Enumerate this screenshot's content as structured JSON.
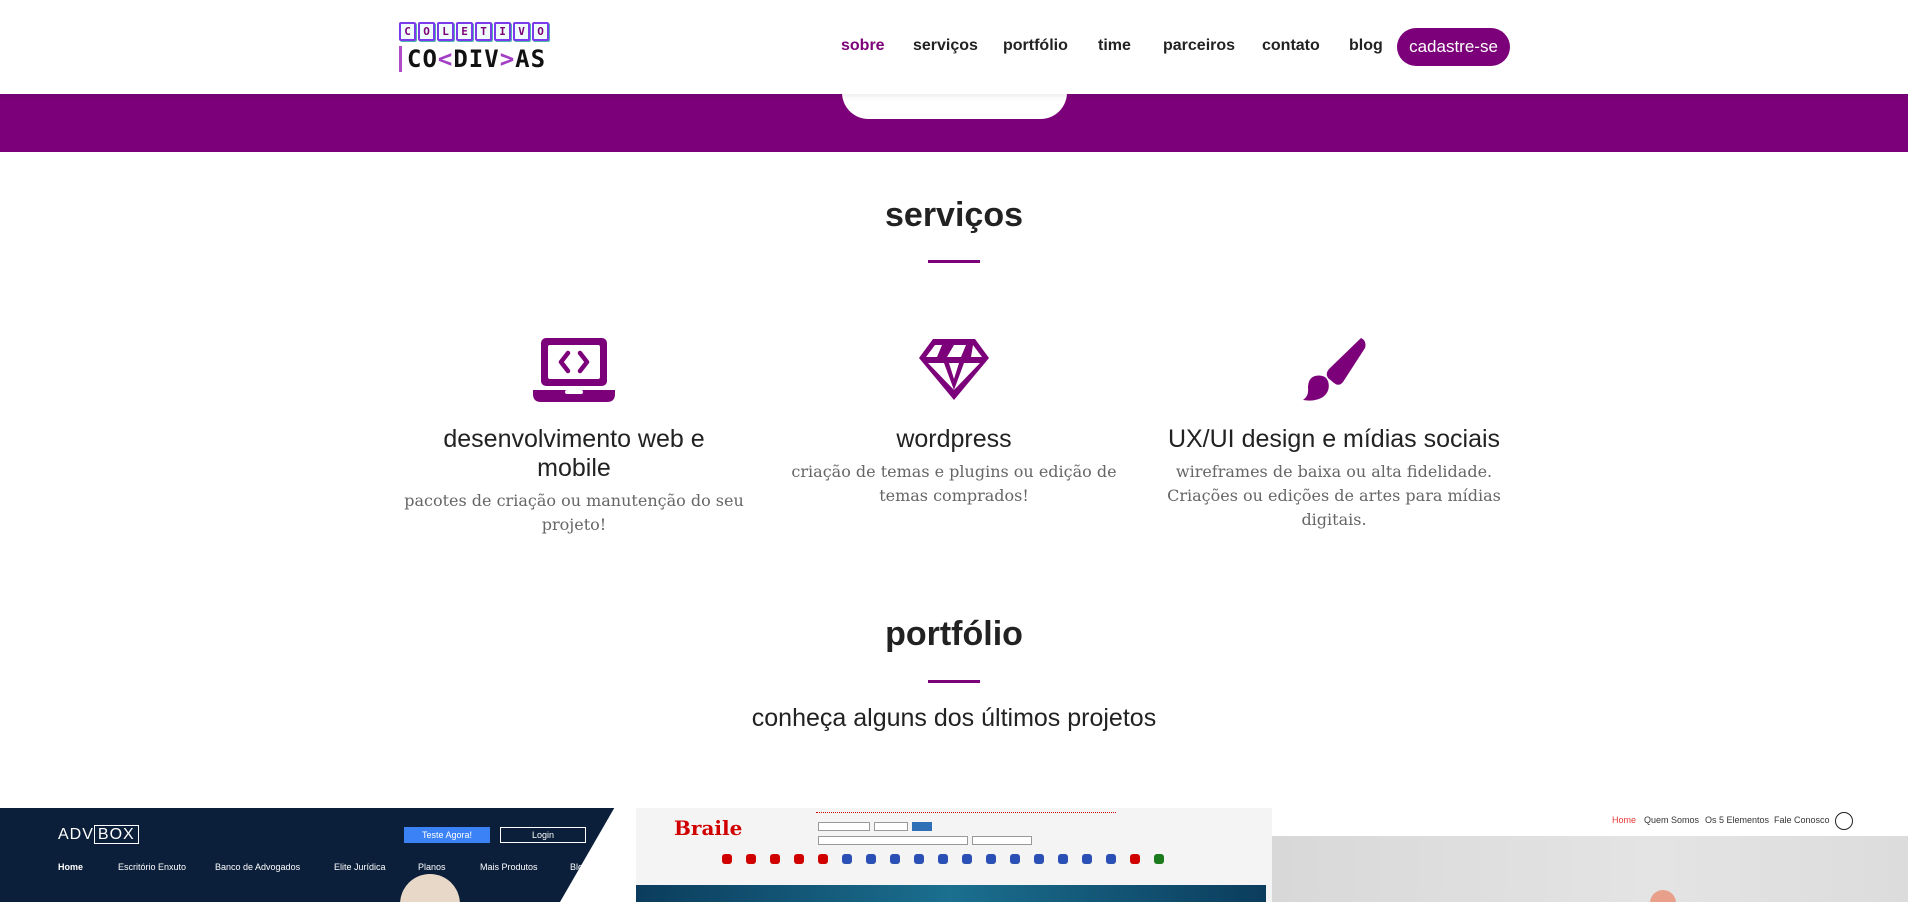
{
  "header": {
    "logo": {
      "top_letters": [
        "C",
        "O",
        "L",
        "E",
        "T",
        "I",
        "V",
        "O"
      ],
      "bottom": {
        "part1": "CO",
        "lt": "<",
        "part2": "DIV",
        "gt": ">",
        "part3": "AS"
      }
    },
    "nav": [
      {
        "label": "sobre",
        "active": true
      },
      {
        "label": "serviços",
        "active": false
      },
      {
        "label": "portfólio",
        "active": false
      },
      {
        "label": "time",
        "active": false
      },
      {
        "label": "parceiros",
        "active": false
      },
      {
        "label": "contato",
        "active": false
      },
      {
        "label": "blog",
        "active": false
      }
    ],
    "cta_label": "cadastre-se"
  },
  "colors": {
    "accent": "#7c0079",
    "text": "#222222",
    "muted": "#666666"
  },
  "services": {
    "title": "serviços",
    "items": [
      {
        "icon": "laptop-code-icon",
        "title": "desenvolvimento web e mobile",
        "description": "pacotes de criação ou manutenção do seu projeto!"
      },
      {
        "icon": "gem-icon",
        "title": "wordpress",
        "description": "criação de temas e plugins ou edição de temas comprados!"
      },
      {
        "icon": "paint-brush-icon",
        "title": "UX/UI design e mídias sociais",
        "description": "wireframes de baixa ou alta fidelidade. Criações ou edições de artes para mídias digitais."
      }
    ]
  },
  "portfolio": {
    "title": "portfólio",
    "subtitle": "conheça alguns dos últimos projetos",
    "thumbs": [
      {
        "brand_a": "ADV",
        "brand_b": "BOX",
        "button_primary": "Teste Agora!",
        "button_secondary": "Login",
        "menu": [
          "Home",
          "Escritório Enxuto",
          "Banco de Advogados",
          "Elite Jurídica",
          "Planos",
          "Mais Produtos",
          "Blog"
        ]
      },
      {
        "logo": "Braile"
      },
      {
        "menu": [
          {
            "label": "Home",
            "active": true
          },
          {
            "label": "Quem Somos",
            "active": false
          },
          {
            "label": "Os 5 Elementos",
            "active": false
          },
          {
            "label": "Fale Conosco",
            "active": false
          }
        ]
      }
    ]
  }
}
